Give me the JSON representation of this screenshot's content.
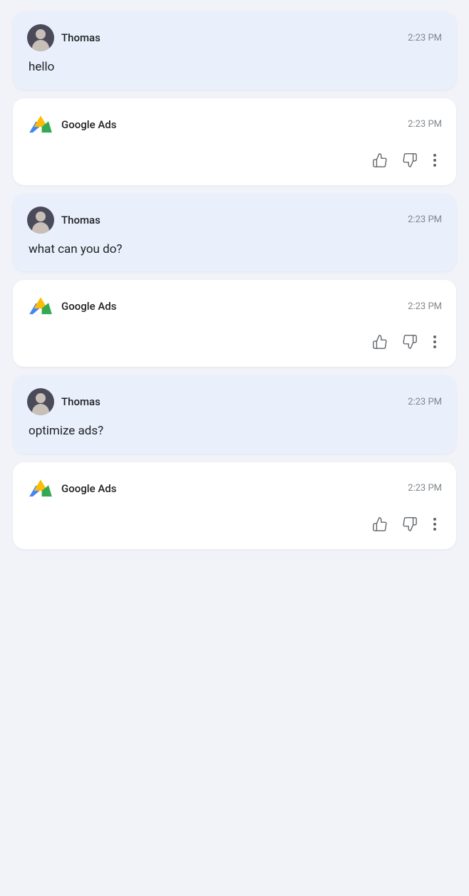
{
  "messages": [
    {
      "id": "msg1",
      "type": "user",
      "sender": "Thomas",
      "timestamp": "2:23 PM",
      "text": "hello",
      "hasActions": false
    },
    {
      "id": "msg2",
      "type": "bot",
      "sender": "Google Ads",
      "timestamp": "2:23 PM",
      "text": "",
      "hasActions": true
    },
    {
      "id": "msg3",
      "type": "user",
      "sender": "Thomas",
      "timestamp": "2:23 PM",
      "text": "what can you do?",
      "hasActions": false
    },
    {
      "id": "msg4",
      "type": "bot",
      "sender": "Google Ads",
      "timestamp": "2:23 PM",
      "text": "",
      "hasActions": true
    },
    {
      "id": "msg5",
      "type": "user",
      "sender": "Thomas",
      "timestamp": "2:23 PM",
      "text": "optimize ads?",
      "hasActions": false
    },
    {
      "id": "msg6",
      "type": "bot",
      "sender": "Google Ads",
      "timestamp": "2:23 PM",
      "text": "",
      "hasActions": true
    }
  ],
  "actions": {
    "like_label": "Like",
    "dislike_label": "Dislike",
    "more_label": "More options"
  }
}
